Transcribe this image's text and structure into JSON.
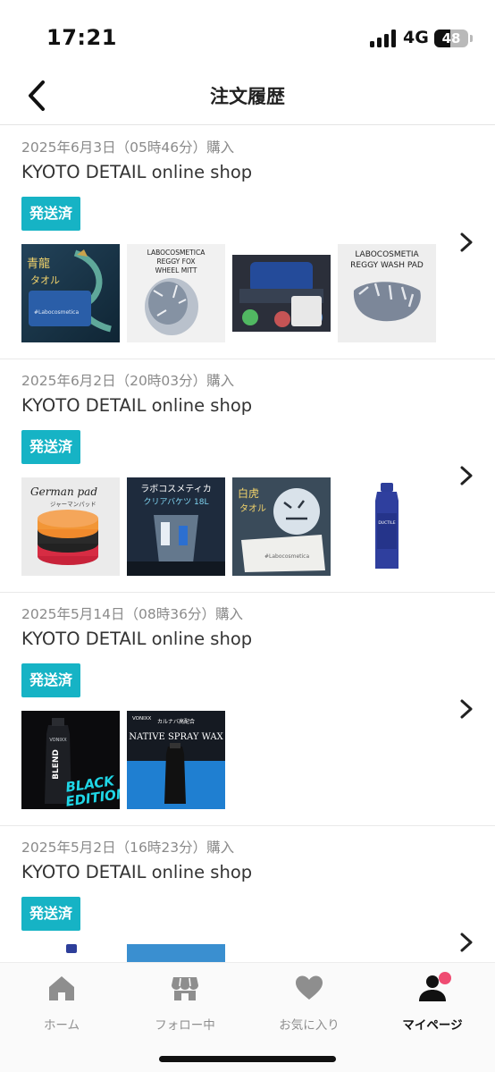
{
  "status_bar": {
    "time": "17:21",
    "network": "4G",
    "battery": "48",
    "battery_level": 0.48
  },
  "header": {
    "title": "注文履歴"
  },
  "orders": [
    {
      "date": "2025年6月3日（05時46分）購入",
      "shop": "KYOTO DETAIL online shop",
      "status": "発送済",
      "thumbnails": [
        {
          "icon": "dragon-towel",
          "text_lines": [
            "青龍",
            "タオル",
            "#Labocosmetica"
          ]
        },
        {
          "icon": "wheel-mitt",
          "text_lines": [
            "LABOCOSMETICA",
            "REGGY FOX",
            "WHEEL MITT"
          ]
        },
        {
          "icon": "led-cart",
          "text_lines": []
        },
        {
          "icon": "wash-pad",
          "text_lines": [
            "LABOCOSMETIA",
            "REGGY WASH PAD"
          ]
        }
      ]
    },
    {
      "date": "2025年6月2日（20時03分）購入",
      "shop": "KYOTO DETAIL online shop",
      "status": "発送済",
      "thumbnails": [
        {
          "icon": "german-pad",
          "text_lines": [
            "German pad",
            "ジャーマンパッド"
          ]
        },
        {
          "icon": "clear-bucket",
          "text_lines": [
            "ラボコスメティカ",
            "クリアバケツ 18L"
          ]
        },
        {
          "icon": "tiger-towel",
          "text_lines": [
            "白虎",
            "タオル",
            "#Labocosmetica"
          ]
        },
        {
          "icon": "blue-bottle",
          "text_lines": [
            "DUCTILE"
          ]
        }
      ]
    },
    {
      "date": "2025年5月14日（08時36分）購入",
      "shop": "KYOTO DETAIL online shop",
      "status": "発送済",
      "thumbnails": [
        {
          "icon": "blend-bottle",
          "text_lines": [
            "VONIXX",
            "BLEND",
            "BLACK",
            "EDITION"
          ]
        },
        {
          "icon": "spray-wax",
          "text_lines": [
            "VONIXX",
            "カルナバ高配合",
            "NATIVE SPRAY WAX"
          ]
        }
      ]
    },
    {
      "date": "2025年5月2日（16時23分）購入",
      "shop": "KYOTO DETAIL online shop",
      "status": "発送済",
      "thumbnails": [
        {
          "icon": "bottle-partial",
          "text_lines": []
        },
        {
          "icon": "blue-image-partial",
          "text_lines": []
        }
      ]
    }
  ],
  "tabs": [
    {
      "label": "ホーム",
      "icon": "home-icon",
      "active": false
    },
    {
      "label": "フォロー中",
      "icon": "shop-icon",
      "active": false
    },
    {
      "label": "お気に入り",
      "icon": "heart-icon",
      "active": false
    },
    {
      "label": "マイページ",
      "icon": "user-icon",
      "active": true,
      "notification": true
    }
  ],
  "colors": {
    "accent": "#16b3c5",
    "notification": "#ef4c72",
    "muted_text": "#8a8a8a",
    "active_tab": "#111111",
    "inactive_tab": "#8e8e8e"
  }
}
